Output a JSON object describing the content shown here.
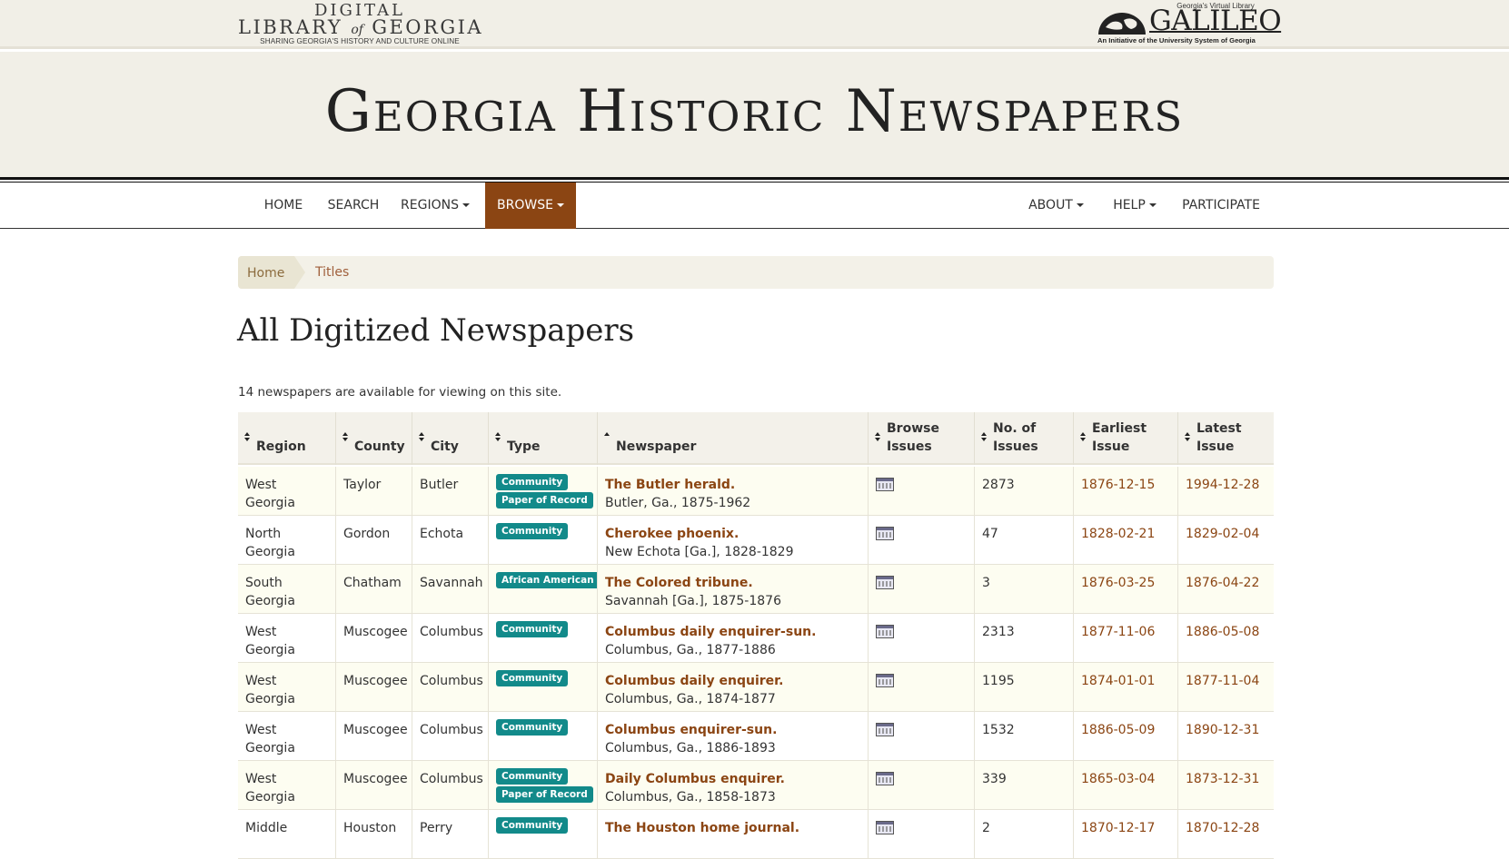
{
  "header": {
    "dlg_line1": "DIGITAL",
    "dlg_line2a": "LIBRARY",
    "dlg_line2b": "of",
    "dlg_line2c": "GEORGIA",
    "dlg_tagline": "SHARING GEORGIA'S HISTORY AND CULTURE ONLINE",
    "galileo_virtual": "Georgia's Virtual Library",
    "galileo_name": "GALILEO",
    "galileo_initiative": "An Initiative of the University System of Georgia",
    "site_title": "Georgia Historic Newspapers"
  },
  "nav": {
    "home": "HOME",
    "search": "SEARCH",
    "regions": "REGIONS",
    "browse": "BROWSE",
    "about": "ABOUT",
    "help": "HELP",
    "participate": "PARTICIPATE"
  },
  "breadcrumb": {
    "home": "Home",
    "current": "Titles"
  },
  "page": {
    "title": "All Digitized Newspapers",
    "summary": "14 newspapers are available for viewing on this site."
  },
  "table": {
    "headers": {
      "region": "Region",
      "county": "County",
      "city": "City",
      "type": "Type",
      "newspaper": "Newspaper",
      "browse1": "Browse",
      "browse2": "Issues",
      "no1": "No. of",
      "no2": "Issues",
      "earliest1": "Earliest",
      "earliest2": "Issue",
      "latest1": "Latest",
      "latest2": "Issue"
    },
    "rows": [
      {
        "region": "West Georgia",
        "county": "Taylor",
        "city": "Butler",
        "types": [
          "Community",
          "Paper of Record"
        ],
        "title": "The Butler herald.",
        "place": "Butler, Ga., 1875-1962",
        "issues": "2873",
        "earliest": "1876-12-15",
        "latest": "1994-12-28"
      },
      {
        "region": "North Georgia",
        "county": "Gordon",
        "city": "Echota",
        "types": [
          "Community"
        ],
        "title": "Cherokee phoenix.",
        "place": "New Echota [Ga.], 1828-1829",
        "issues": "47",
        "earliest": "1828-02-21",
        "latest": "1829-02-04"
      },
      {
        "region": "South Georgia",
        "county": "Chatham",
        "city": "Savannah",
        "types": [
          "African American"
        ],
        "title": "The Colored tribune.",
        "place": "Savannah [Ga.], 1875-1876",
        "issues": "3",
        "earliest": "1876-03-25",
        "latest": "1876-04-22"
      },
      {
        "region": "West Georgia",
        "county": "Muscogee",
        "city": "Columbus",
        "types": [
          "Community"
        ],
        "title": "Columbus daily enquirer-sun.",
        "place": "Columbus, Ga., 1877-1886",
        "issues": "2313",
        "earliest": "1877-11-06",
        "latest": "1886-05-08"
      },
      {
        "region": "West Georgia",
        "county": "Muscogee",
        "city": "Columbus",
        "types": [
          "Community"
        ],
        "title": "Columbus daily enquirer.",
        "place": "Columbus, Ga., 1874-1877",
        "issues": "1195",
        "earliest": "1874-01-01",
        "latest": "1877-11-04"
      },
      {
        "region": "West Georgia",
        "county": "Muscogee",
        "city": "Columbus",
        "types": [
          "Community"
        ],
        "title": "Columbus enquirer-sun.",
        "place": "Columbus, Ga., 1886-1893",
        "issues": "1532",
        "earliest": "1886-05-09",
        "latest": "1890-12-31"
      },
      {
        "region": "West Georgia",
        "county": "Muscogee",
        "city": "Columbus",
        "types": [
          "Community",
          "Paper of Record"
        ],
        "title": "Daily Columbus enquirer.",
        "place": "Columbus, Ga., 1858-1873",
        "issues": "339",
        "earliest": "1865-03-04",
        "latest": "1873-12-31"
      },
      {
        "region": "Middle",
        "county": "Houston",
        "city": "Perry",
        "types": [
          "Community"
        ],
        "title": "The Houston home journal.",
        "place": "",
        "issues": "2",
        "earliest": "1870-12-17",
        "latest": "1870-12-28"
      }
    ]
  },
  "colors": {
    "accent": "#8b4513",
    "badge": "#128a8a",
    "masthead_bg": "#f1efe7",
    "row_alt": "#fdfdf1"
  }
}
